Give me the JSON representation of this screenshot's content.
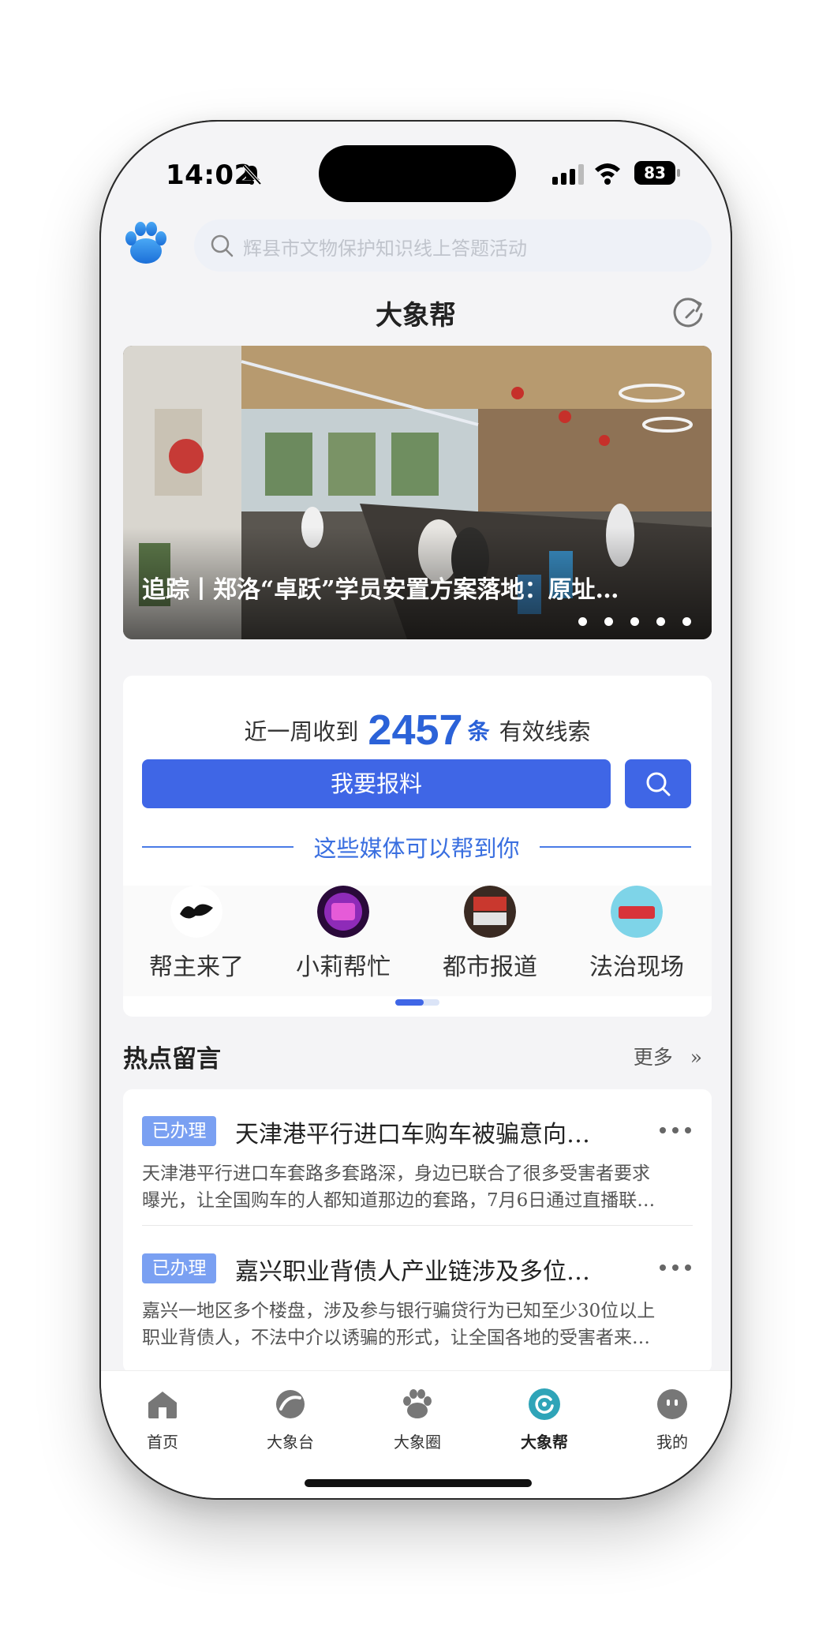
{
  "status_bar": {
    "time": "14:02",
    "battery": "83"
  },
  "header": {
    "search_placeholder": "辉县市文物保护知识线上答题活动",
    "title": "大象帮"
  },
  "banner": {
    "caption": "追踪丨郑洛“卓跃”学员安置方案落地：原址…",
    "slide_count": 5
  },
  "clue_card": {
    "pre_text": "近一周收到",
    "count": "2457",
    "unit": "条",
    "post_text": "有效线索",
    "report_button": "我要报料",
    "media_heading": "这些媒体可以帮到你",
    "media": [
      {
        "name": "帮主来了",
        "avatar_icon": "bangzhu-logo-icon"
      },
      {
        "name": "小莉帮忙",
        "avatar_icon": "xiaoli-logo-icon"
      },
      {
        "name": "都市报道",
        "avatar_icon": "dushi-logo-icon"
      },
      {
        "name": "法治现场",
        "avatar_icon": "fazhi-logo-icon"
      }
    ]
  },
  "hot_comments": {
    "title": "热点留言",
    "more": "更多",
    "items": [
      {
        "badge": "已办理",
        "title": "天津港平行进口车购车被骗意向…",
        "line1": "天津港平行进口车套路多套路深，身边已联合了很多受害者要求",
        "line2": "曝光，让全国购车的人都知道那边的套路，7月6日通过直播联…"
      },
      {
        "badge": "已办理",
        "title": "嘉兴职业背债人产业链涉及多位…",
        "line1": "嘉兴一地区多个楼盘，涉及参与银行骗贷行为已知至少30位以上",
        "line2": "职业背债人，不法中介以诱骗的形式，让全国各地的受害者来…"
      }
    ]
  },
  "tabbar": {
    "tabs": [
      {
        "label": "首页",
        "icon": "home-icon"
      },
      {
        "label": "大象台",
        "icon": "tv-icon"
      },
      {
        "label": "大象圈",
        "icon": "paw-icon"
      },
      {
        "label": "大象帮",
        "icon": "help-icon",
        "active": true
      },
      {
        "label": "我的",
        "icon": "profile-icon"
      }
    ],
    "accent": "#2fa4b8"
  },
  "colors": {
    "primary": "#3f66e6",
    "badge": "#7aa0f2"
  }
}
